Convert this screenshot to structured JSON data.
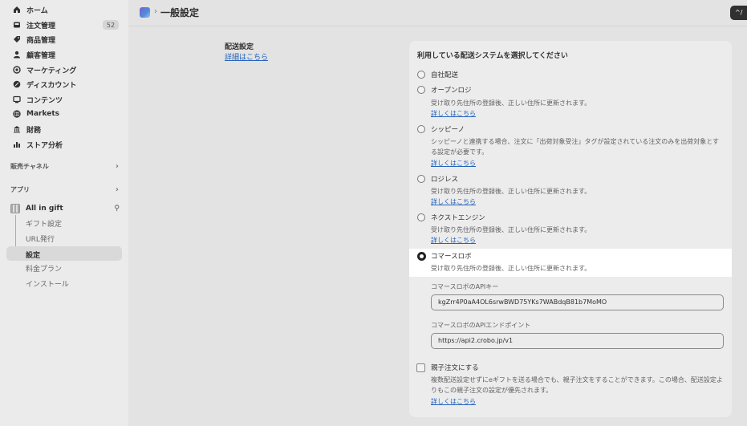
{
  "sidebar": {
    "items": [
      {
        "label": "ホーム",
        "icon": "home-icon"
      },
      {
        "label": "注文管理",
        "icon": "inbox-icon",
        "badge": "52"
      },
      {
        "label": "商品管理",
        "icon": "tag-icon"
      },
      {
        "label": "顧客管理",
        "icon": "person-icon"
      },
      {
        "label": "マーケティング",
        "icon": "target-icon"
      },
      {
        "label": "ディスカウント",
        "icon": "discount-icon"
      },
      {
        "label": "コンテンツ",
        "icon": "content-icon"
      },
      {
        "label": "Markets",
        "icon": "globe-icon"
      },
      {
        "label": "財務",
        "icon": "bank-icon"
      },
      {
        "label": "ストア分析",
        "icon": "bar-chart-icon"
      }
    ],
    "sales_channels": "販売チャネル",
    "apps": "アプリ",
    "app_name": "All in gift",
    "app_sub": [
      "ギフト設定",
      "URL発行",
      "設定",
      "料金プラン",
      "インストール"
    ]
  },
  "header": {
    "title": "一般設定",
    "button": "^/"
  },
  "section": {
    "title": "配送設定",
    "link": "詳細はこちら"
  },
  "card": {
    "title": "利用している配送システムを選択してください",
    "options": [
      {
        "label": "自社配送"
      },
      {
        "label": "オープンロジ",
        "desc": "受け取り先住所の登録後、正しい住所に更新されます。",
        "link": "詳しくはこちら"
      },
      {
        "label": "シッピーノ",
        "desc": "シッピーノと連携する場合、注文に「出荷対象受注」タグが設定されている注文のみを出荷対象とする設定が必要です。",
        "link": "詳しくはこちら"
      },
      {
        "label": "ロジレス",
        "desc": "受け取り先住所の登録後、正しい住所に更新されます。",
        "link": "詳しくはこちら"
      },
      {
        "label": "ネクストエンジン",
        "desc": "受け取り先住所の登録後、正しい住所に更新されます。",
        "link": "詳しくはこちら"
      },
      {
        "label": "コマースロボ",
        "desc": "受け取り先住所の登録後、正しい住所に更新されます。",
        "selected": true
      }
    ],
    "api_key_label": "コマースロボのAPIキー",
    "api_key_value": "kgZrr4P0aA4OL6srwBWD75YKs7WABdqB81b7MoMO",
    "endpoint_label": "コマースロボのAPIエンドポイント",
    "endpoint_value": "https://api2.crobo.jp/v1",
    "parent_child": {
      "label": "親子注文にする",
      "desc": "複数配送設定せずにeギフトを送る場合でも、親子注文をすることができます。この場合、配送設定よりもこの親子注文の設定が優先されます。",
      "link": "詳しくはこちら",
      "checked": false
    }
  }
}
